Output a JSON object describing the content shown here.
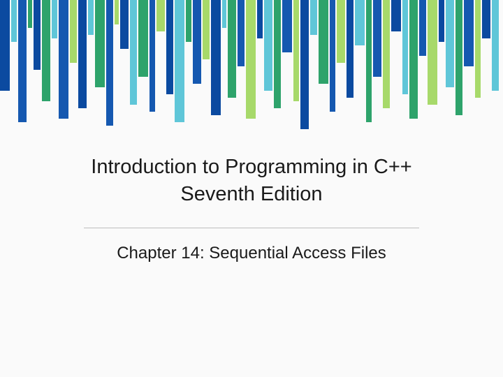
{
  "title_line1": "Introduction to Programming in C++",
  "title_line2": "Seventh Edition",
  "subtitle": "Chapter 14: Sequential Access Files"
}
